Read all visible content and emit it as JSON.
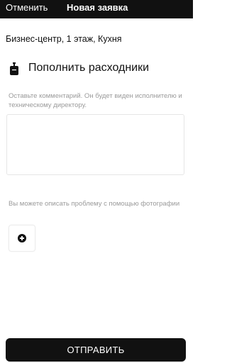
{
  "header": {
    "cancel_label": "Отменить",
    "title": "Новая заявка"
  },
  "location": "Бизнес-центр, 1 этаж, Кухня",
  "category": {
    "icon": "soap-dispenser-icon",
    "label": "Пополнить расходники"
  },
  "comment": {
    "hint": "Оставьте комментарий. Он будет виден исполнителю и техническому директору.",
    "value": ""
  },
  "photo": {
    "hint": "Вы можете описать проблему с помощью фотографии",
    "add_icon": "plus-circle-icon"
  },
  "submit_label": "ОТПРАВИТЬ"
}
